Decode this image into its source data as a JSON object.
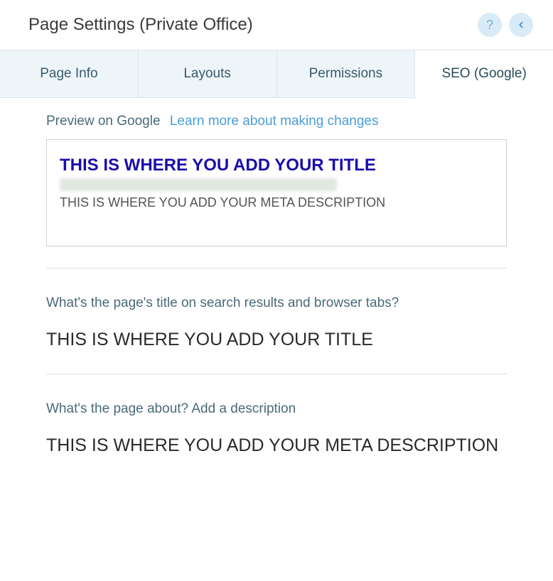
{
  "header": {
    "title": "Page Settings (Private Office)"
  },
  "tabs": {
    "page_info": "Page Info",
    "layouts": "Layouts",
    "permissions": "Permissions",
    "seo": "SEO (Google)"
  },
  "preview": {
    "label": "Preview on Google",
    "learn_link": "Learn more about making changes",
    "title": "THIS IS WHERE YOU ADD YOUR TITLE",
    "description": "THIS IS WHERE YOU ADD YOUR META DESCRIPTION"
  },
  "fields": {
    "title_label": "What's the page's title on search results and browser tabs?",
    "title_value": "THIS IS WHERE YOU ADD YOUR TITLE",
    "desc_label": "What's the page about? Add a description",
    "desc_value": "THIS IS WHERE YOU ADD YOUR META DESCRIPTION"
  }
}
